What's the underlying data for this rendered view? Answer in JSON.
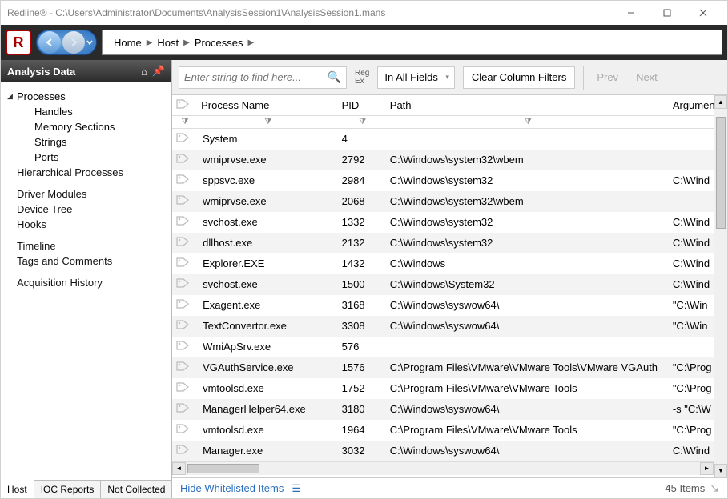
{
  "window": {
    "title": "Redline® - C:\\Users\\Administrator\\Documents\\AnalysisSession1\\AnalysisSession1.mans",
    "logo_letter": "R"
  },
  "breadcrumb": [
    "Home",
    "Host",
    "Processes"
  ],
  "sidebar": {
    "title": "Analysis Data",
    "tree": {
      "processes": "Processes",
      "children": [
        "Handles",
        "Memory Sections",
        "Strings",
        "Ports"
      ],
      "hierarchical": "Hierarchical Processes",
      "driver_modules": "Driver Modules",
      "device_tree": "Device Tree",
      "hooks": "Hooks",
      "timeline": "Timeline",
      "tags": "Tags and Comments",
      "acquisition": "Acquisition History"
    },
    "tabs": [
      "Host",
      "IOC Reports",
      "Not Collected"
    ]
  },
  "filters": {
    "search_placeholder": "Enter string to find here...",
    "regex_label": "Reg\nEx",
    "field_select": "In All Fields",
    "clear_button": "Clear Column Filters",
    "prev": "Prev",
    "next": "Next"
  },
  "columns": {
    "name": "Process Name",
    "pid": "PID",
    "path": "Path",
    "args": "Arguments"
  },
  "rows": [
    {
      "name": "System",
      "pid": "4",
      "path": "",
      "args": ""
    },
    {
      "name": "wmiprvse.exe",
      "pid": "2792",
      "path": "C:\\Windows\\system32\\wbem",
      "args": ""
    },
    {
      "name": "sppsvc.exe",
      "pid": "2984",
      "path": "C:\\Windows\\system32",
      "args": "C:\\Wind"
    },
    {
      "name": "wmiprvse.exe",
      "pid": "2068",
      "path": "C:\\Windows\\system32\\wbem",
      "args": ""
    },
    {
      "name": "svchost.exe",
      "pid": "1332",
      "path": "C:\\Windows\\system32",
      "args": "C:\\Wind"
    },
    {
      "name": "dllhost.exe",
      "pid": "2132",
      "path": "C:\\Windows\\system32",
      "args": "C:\\Wind"
    },
    {
      "name": "Explorer.EXE",
      "pid": "1432",
      "path": "C:\\Windows",
      "args": "C:\\Wind"
    },
    {
      "name": "svchost.exe",
      "pid": "1500",
      "path": "C:\\Windows\\System32",
      "args": "C:\\Wind"
    },
    {
      "name": " Exagent.exe",
      "pid": "3168",
      "path": "C:\\Windows\\syswow64\\",
      "args": "\"C:\\Win"
    },
    {
      "name": "TextConvertor.exe",
      "pid": "3308",
      "path": "C:\\Windows\\syswow64\\",
      "args": "\"C:\\Win"
    },
    {
      "name": "WmiApSrv.exe",
      "pid": "576",
      "path": "",
      "args": ""
    },
    {
      "name": "VGAuthService.exe",
      "pid": "1576",
      "path": "C:\\Program Files\\VMware\\VMware Tools\\VMware VGAuth",
      "args": "\"C:\\Prog"
    },
    {
      "name": "vmtoolsd.exe",
      "pid": "1752",
      "path": "C:\\Program Files\\VMware\\VMware Tools",
      "args": "\"C:\\Prog"
    },
    {
      "name": "ManagerHelper64.exe",
      "pid": "3180",
      "path": "C:\\Windows\\syswow64\\",
      "args": "-s \"C:\\W"
    },
    {
      "name": "vmtoolsd.exe",
      "pid": "1964",
      "path": "C:\\Program Files\\VMware\\VMware Tools",
      "args": "\"C:\\Prog"
    },
    {
      "name": " Manager.exe",
      "pid": "3032",
      "path": "C:\\Windows\\syswow64\\",
      "args": "C:\\Wind"
    }
  ],
  "status": {
    "hide_link": "Hide Whitelisted Items",
    "count": "45 Items"
  }
}
